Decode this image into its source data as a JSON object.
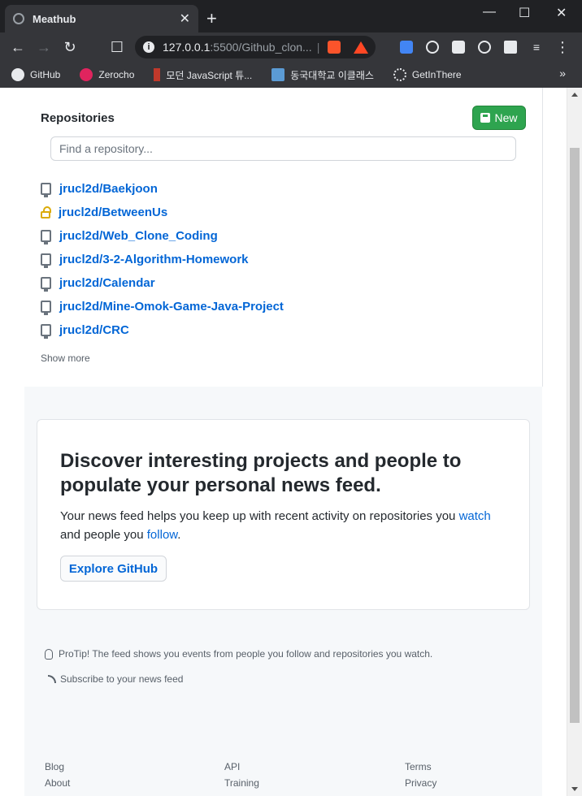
{
  "browser": {
    "tab_title": "Meathub",
    "tab_close": "✕",
    "new_tab": "+",
    "url_host": "127.0.0.1",
    "url_rest": ":5500/Github_clon...",
    "win_minimize": "—",
    "win_maximize": "☐",
    "win_close": "✕",
    "bookmarks": [
      {
        "label": "GitHub",
        "color": "#e8eaed"
      },
      {
        "label": "Zerocho",
        "color": "#e0245e"
      },
      {
        "label": "모던 JavaScript 튜...",
        "color": "#c0392b"
      },
      {
        "label": "동국대학교 이클래스",
        "color": "#5b9bd5"
      },
      {
        "label": "GetInThere",
        "color": "#e8eaed"
      }
    ],
    "bookmarks_more": "»"
  },
  "sidebar": {
    "heading": "Repositories",
    "new_button": "New",
    "search_placeholder": "Find a repository...",
    "repos": [
      {
        "name": "jrucl2d/Baekjoon",
        "icon": "repo-icon"
      },
      {
        "name": "jrucl2d/BetweenUs",
        "icon": "lock-icon"
      },
      {
        "name": "jrucl2d/Web_Clone_Coding",
        "icon": "repo-icon"
      },
      {
        "name": "jrucl2d/3-2-Algorithm-Homework",
        "icon": "repo-icon"
      },
      {
        "name": "jrucl2d/Calendar",
        "icon": "repo-icon"
      },
      {
        "name": "jrucl2d/Mine-Omok-Game-Java-Project",
        "icon": "repo-icon"
      },
      {
        "name": "jrucl2d/CRC",
        "icon": "repo-icon"
      }
    ],
    "show_more": "Show more"
  },
  "feed": {
    "title": "Discover interesting projects and people to populate your personal news feed.",
    "text_before": "Your news feed helps you keep up with recent activity on repositories you ",
    "watch_link": "watch",
    "text_middle": " and people you ",
    "follow_link": "follow",
    "text_after": ".",
    "explore_button": "Explore GitHub",
    "protip": "ProTip! The feed shows you events from people you follow and repositories you watch.",
    "subscribe": "Subscribe to your news feed"
  },
  "footer": {
    "col1": [
      "Blog",
      "About"
    ],
    "col2": [
      "API",
      "Training"
    ],
    "col3": [
      "Terms",
      "Privacy"
    ]
  },
  "colors": {
    "link": "#0366d6",
    "new_button": "#2ea44f",
    "lock": "#dbab09"
  }
}
